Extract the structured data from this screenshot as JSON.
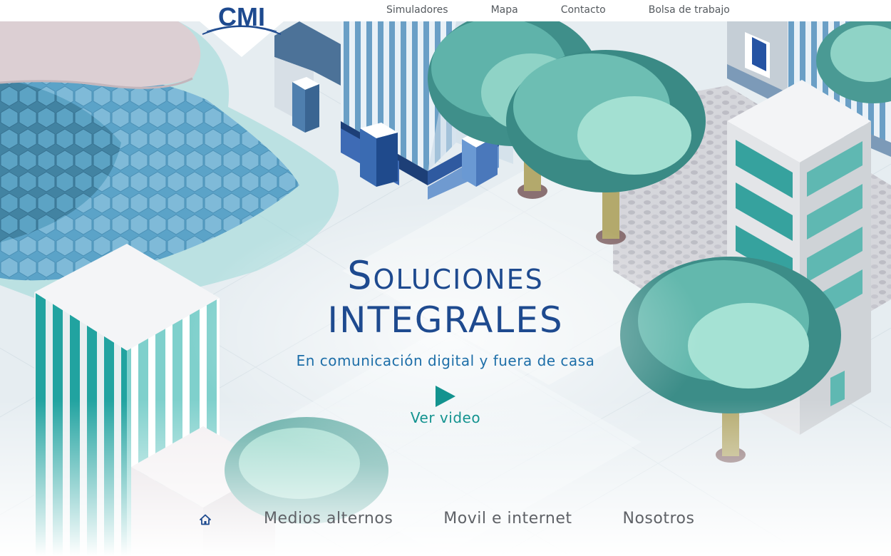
{
  "header": {
    "logo_text": "CMI",
    "nav": [
      {
        "label": "Simuladores"
      },
      {
        "label": "Mapa"
      },
      {
        "label": "Contacto"
      },
      {
        "label": "Bolsa de trabajo"
      }
    ]
  },
  "hero": {
    "title_line1": "Soluciones",
    "title_line2": "integrales",
    "subtitle": "En comunicación digital y fuera de casa",
    "play_icon": "play-icon",
    "video_label": "Ver video"
  },
  "bottom_nav": {
    "home_icon": "home-icon",
    "items": [
      {
        "label": "Medios alternos"
      },
      {
        "label": "Movil e internet"
      },
      {
        "label": "Nosotros"
      }
    ]
  },
  "colors": {
    "brand_blue": "#1e4a8f",
    "subtitle_blue": "#1d6ea8",
    "teal_accent": "#13938f",
    "nav_gray": "#555a5f"
  }
}
